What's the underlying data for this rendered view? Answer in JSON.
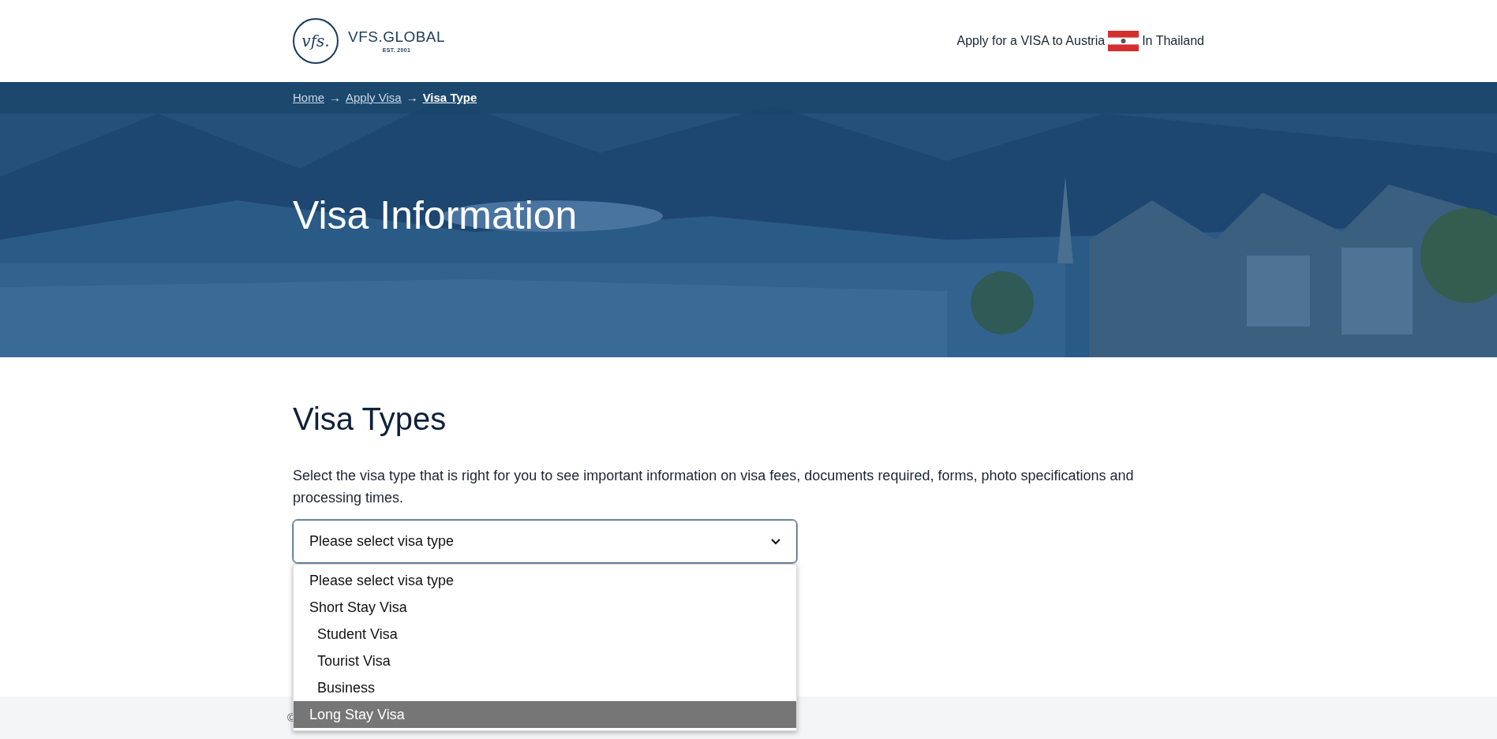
{
  "header": {
    "logo_mark": "vfs.",
    "logo_name": "VFS.GLOBAL",
    "logo_tagline": "EST. 2001",
    "apply_text": "Apply for a VISA to Austria",
    "location_text": "In Thailand"
  },
  "breadcrumb": [
    {
      "label": "Home",
      "current": false
    },
    {
      "label": "Apply Visa",
      "current": false
    },
    {
      "label": "Visa Type",
      "current": true
    }
  ],
  "breadcrumb_separator": "→",
  "hero": {
    "title": "Visa Information"
  },
  "section": {
    "title": "Visa Types",
    "description": "Select the visa type that is right for you to see important information on visa fees, documents required, forms, photo specifications and processing times."
  },
  "visa_select": {
    "value": "Please select visa type",
    "expanded": true,
    "options": [
      {
        "label": "Please select visa type",
        "highlighted": false
      },
      {
        "label": "Short Stay Visa",
        "highlighted": false,
        "children": [
          {
            "label": "Student Visa",
            "highlighted": false
          },
          {
            "label": "Tourist Visa",
            "highlighted": false
          },
          {
            "label": "Business",
            "highlighted": false
          }
        ]
      },
      {
        "label": "Long Stay Visa",
        "highlighted": true
      }
    ]
  },
  "footer": {
    "text": "©"
  }
}
